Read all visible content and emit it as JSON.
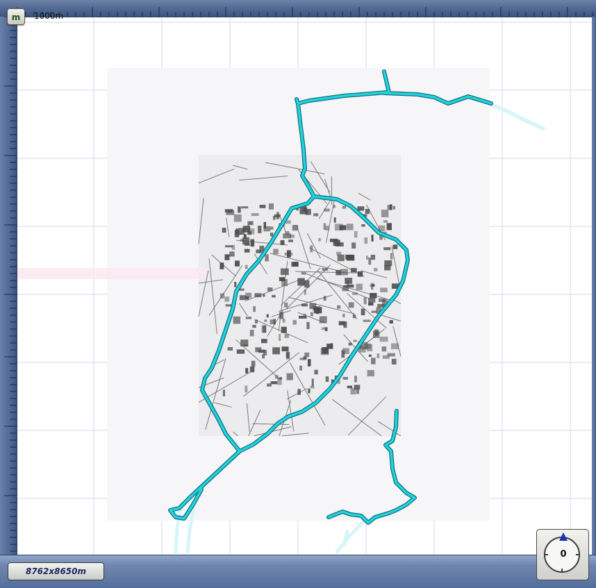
{
  "scale": {
    "button_label": "m",
    "label": "1000m"
  },
  "map": {
    "dimensions_label": "8762x8650m",
    "route_color": "#22d3e0",
    "grid_color": "#d6d4f0"
  },
  "compass": {
    "heading": "0"
  }
}
